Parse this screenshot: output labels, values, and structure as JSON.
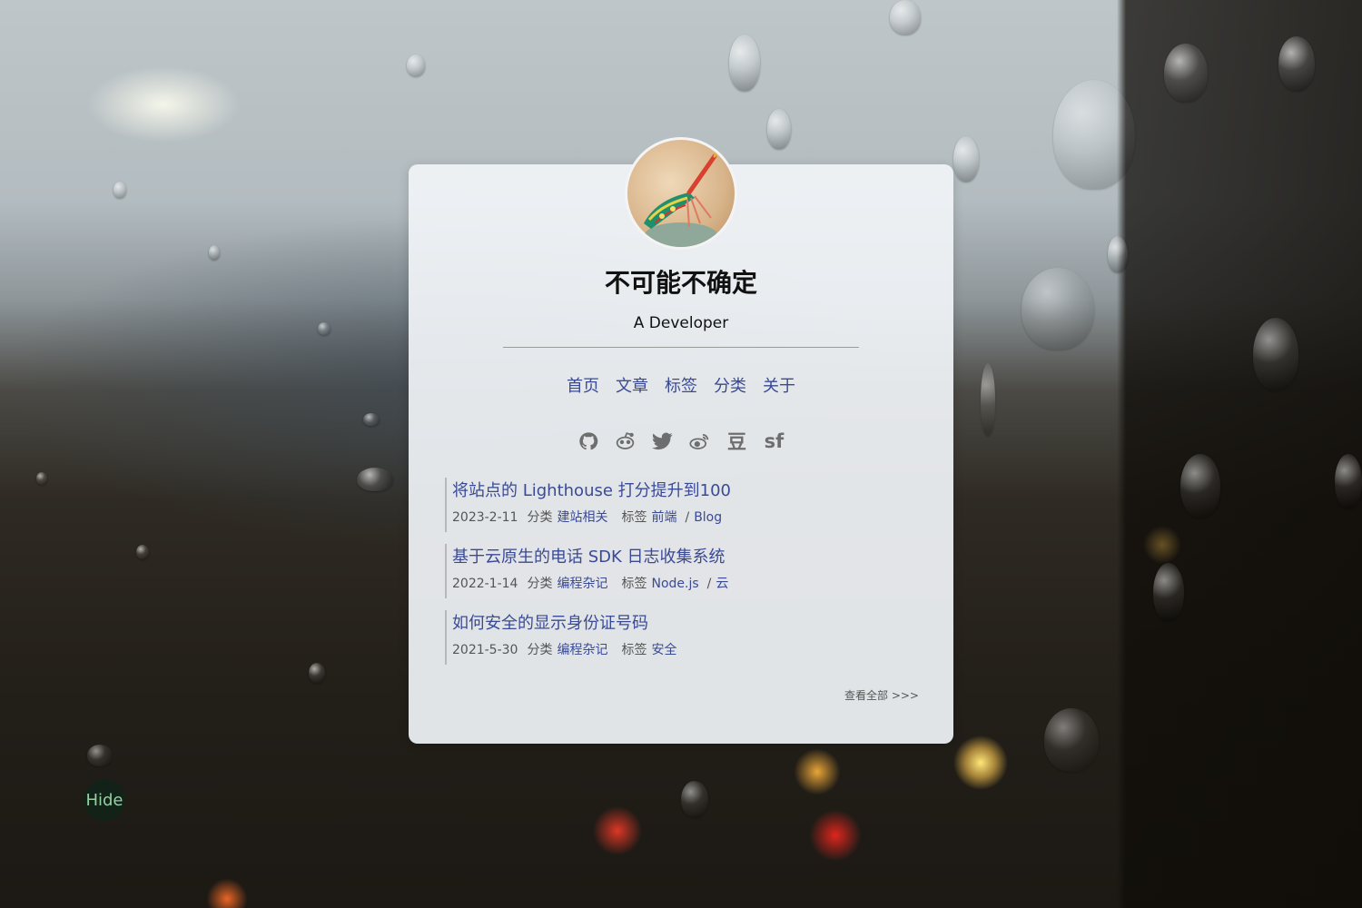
{
  "site": {
    "title": "不可能不确定",
    "subtitle": "A Developer"
  },
  "nav": [
    {
      "label": "首页"
    },
    {
      "label": "文章"
    },
    {
      "label": "标签"
    },
    {
      "label": "分类"
    },
    {
      "label": "关于"
    }
  ],
  "social": {
    "icons": [
      "github-icon",
      "reddit-icon",
      "twitter-icon",
      "weibo-icon",
      "douban-icon",
      "segmentfault-icon"
    ],
    "douban_text": "豆",
    "segmentfault_text": "sf"
  },
  "labels": {
    "category": "分类",
    "tag": "标签"
  },
  "posts": [
    {
      "title": "将站点的 Lighthouse 打分提升到100",
      "date": "2023-2-11",
      "category": "建站相关",
      "tags": [
        "前端",
        "Blog"
      ]
    },
    {
      "title": "基于云原生的电话 SDK 日志收集系统",
      "date": "2022-1-14",
      "category": "编程杂记",
      "tags": [
        "Node.js",
        "云"
      ]
    },
    {
      "title": "如何安全的显示身份证号码",
      "date": "2021-5-30",
      "category": "编程杂记",
      "tags": [
        "安全"
      ]
    }
  ],
  "view_all": "查看全部 >>>",
  "hide_button": "Hide",
  "colors": {
    "link": "#3a4a95",
    "card_bg": "#f0f3f6",
    "hide_text": "#93d0a4"
  }
}
